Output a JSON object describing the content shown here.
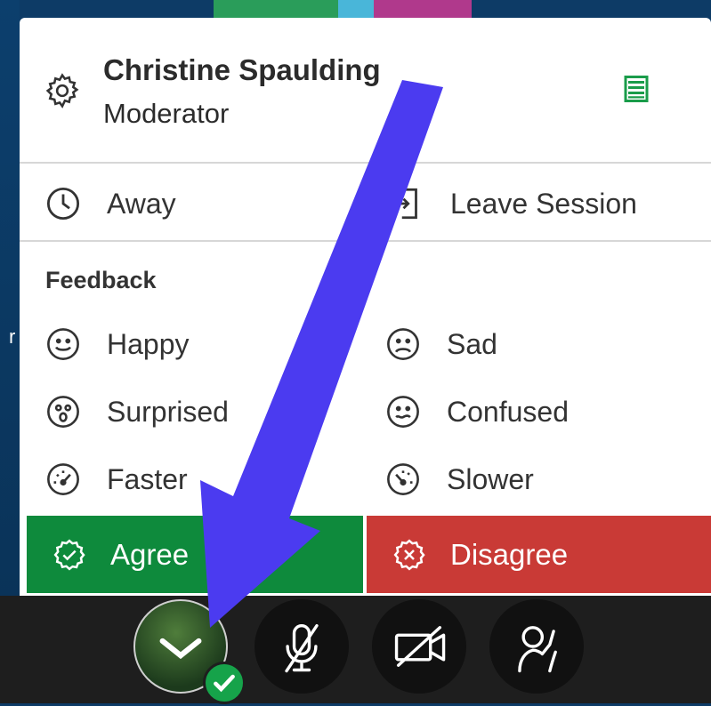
{
  "user": {
    "name": "Christine Spaulding",
    "role": "Moderator"
  },
  "status_menu": {
    "away_label": "Away",
    "leave_label": "Leave Session"
  },
  "feedback": {
    "title": "Feedback",
    "options": [
      {
        "label": "Happy",
        "icon": "happy-face-icon"
      },
      {
        "label": "Sad",
        "icon": "sad-face-icon"
      },
      {
        "label": "Surprised",
        "icon": "surprised-face-icon"
      },
      {
        "label": "Confused",
        "icon": "confused-face-icon"
      },
      {
        "label": "Faster",
        "icon": "speedometer-fast-icon"
      },
      {
        "label": "Slower",
        "icon": "speedometer-slow-icon"
      }
    ]
  },
  "actions": {
    "agree_label": "Agree",
    "disagree_label": "Disagree"
  },
  "colors": {
    "agree": "#0e8a3c",
    "disagree": "#c93a36",
    "toolbar": "#1e1e1e",
    "annotation_arrow": "#4b3bf0",
    "list_icon": "#1a9c4a"
  }
}
